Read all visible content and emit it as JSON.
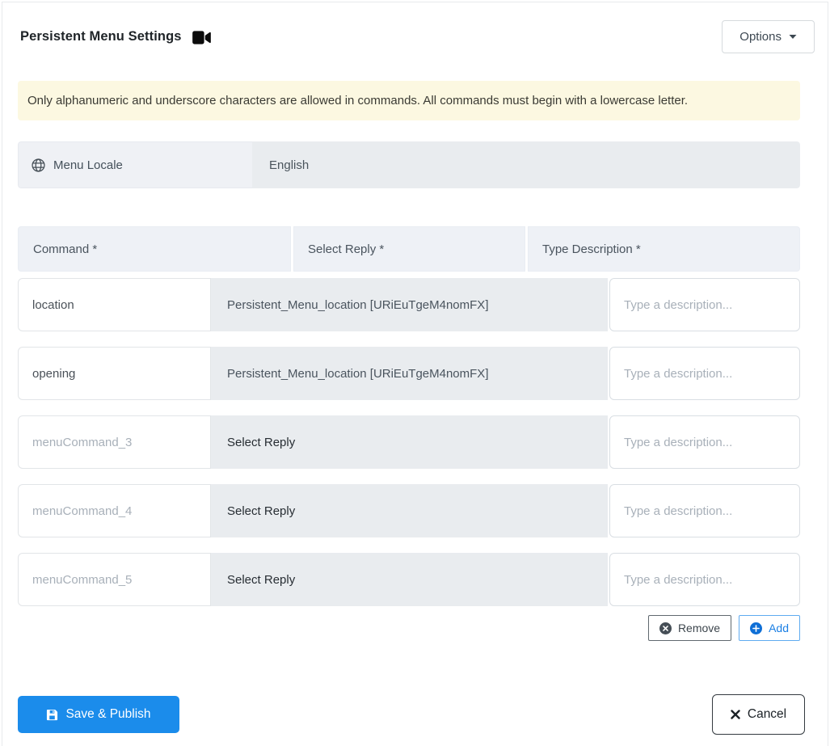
{
  "header": {
    "title": "Persistent Menu Settings",
    "options_label": "Options"
  },
  "alert": {
    "text": "Only alphanumeric and underscore characters are allowed in commands. All commands must begin with a lowercase letter."
  },
  "locale": {
    "label": "Menu Locale",
    "value": "English"
  },
  "table": {
    "headers": [
      "Command *",
      "Select Reply *",
      "Type Description *"
    ],
    "rows": [
      {
        "command_value": "location",
        "command_placeholder": "",
        "reply": "Persistent_Menu_location [URiEuTgeM4nomFX]",
        "reply_is_set": true,
        "description_value": "",
        "description_placeholder": "Type a description..."
      },
      {
        "command_value": "opening",
        "command_placeholder": "",
        "reply": "Persistent_Menu_location [URiEuTgeM4nomFX]",
        "reply_is_set": true,
        "description_value": "",
        "description_placeholder": "Type a description..."
      },
      {
        "command_value": "",
        "command_placeholder": "menuCommand_3",
        "reply": "Select Reply",
        "reply_is_set": false,
        "description_value": "",
        "description_placeholder": "Type a description..."
      },
      {
        "command_value": "",
        "command_placeholder": "menuCommand_4",
        "reply": "Select Reply",
        "reply_is_set": false,
        "description_value": "",
        "description_placeholder": "Type a description..."
      },
      {
        "command_value": "",
        "command_placeholder": "menuCommand_5",
        "reply": "Select Reply",
        "reply_is_set": false,
        "description_value": "",
        "description_placeholder": "Type a description..."
      }
    ]
  },
  "row_actions": {
    "remove_label": "Remove",
    "add_label": "Add"
  },
  "footer": {
    "save_label": "Save & Publish",
    "cancel_label": "Cancel"
  },
  "colors": {
    "primary_blue": "#1b8ceb",
    "add_blue": "#1b7fe4",
    "alert_bg": "#fcf8e1",
    "select_bg": "#e9ecef",
    "header_cell_bg": "#eef1f6",
    "dark_text": "#1f2428"
  }
}
